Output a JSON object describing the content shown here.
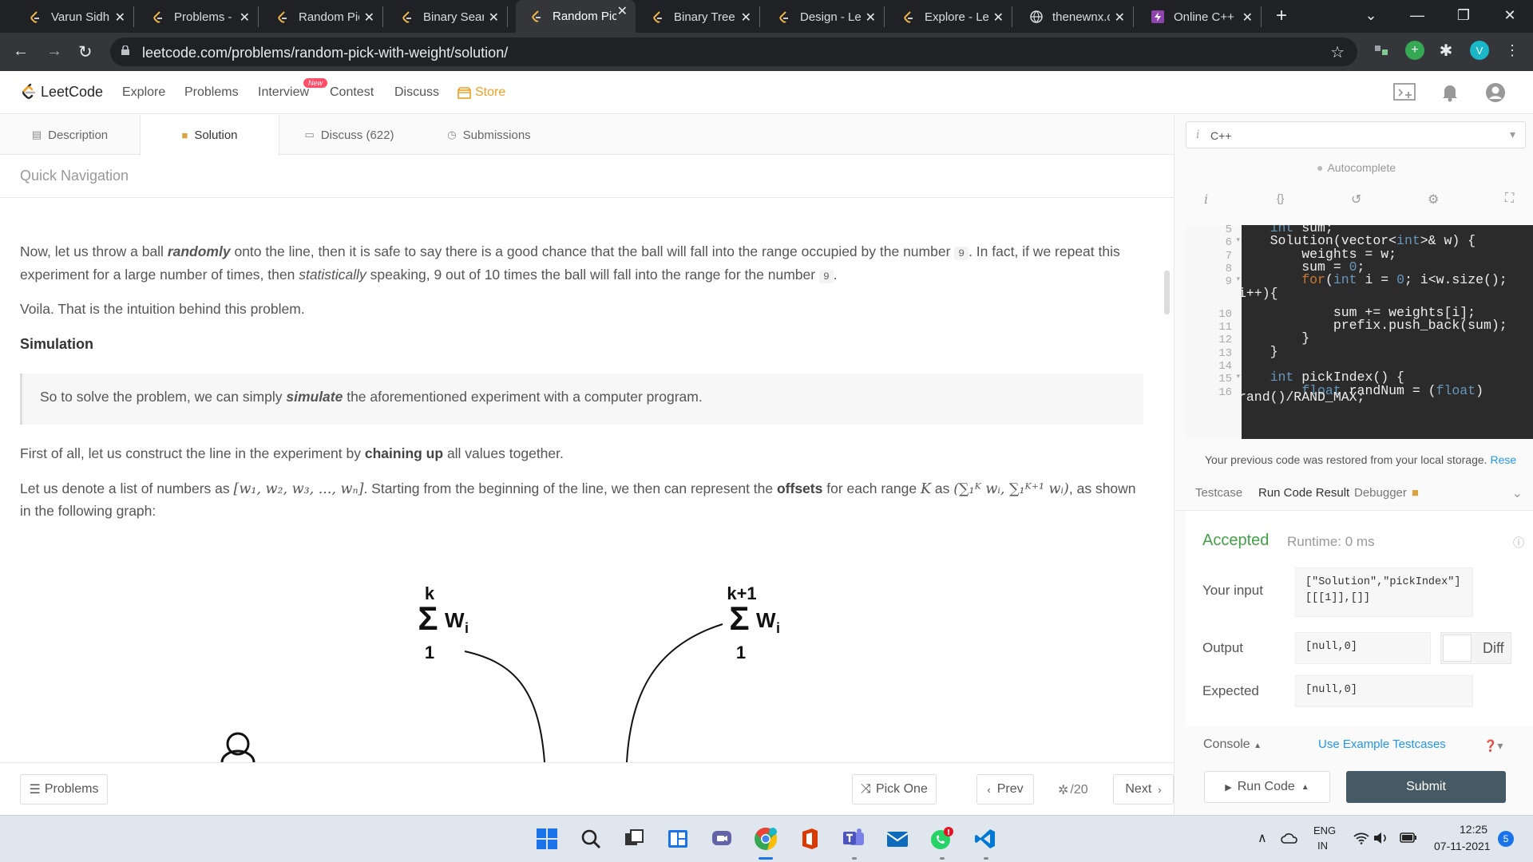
{
  "browser": {
    "tabs": [
      {
        "title": "Varun Sidhu",
        "icon": "leetcode-favicon"
      },
      {
        "title": "Problems -",
        "icon": "leetcode-favicon"
      },
      {
        "title": "Random Pic",
        "icon": "leetcode-favicon"
      },
      {
        "title": "Binary Searc",
        "icon": "leetcode-favicon"
      },
      {
        "title": "Random Pic",
        "icon": "leetcode-favicon",
        "active": true
      },
      {
        "title": "Binary Tree",
        "icon": "leetcode-favicon"
      },
      {
        "title": "Design - Le",
        "icon": "leetcode-favicon"
      },
      {
        "title": "Explore - Le",
        "icon": "leetcode-favicon"
      },
      {
        "title": "thenewnx.c",
        "icon": "globe-favicon"
      },
      {
        "title": "Online C++",
        "icon": "bolt-favicon"
      }
    ],
    "url": "leetcode.com/problems/random-pick-with-weight/solution/",
    "profile_initial": "V"
  },
  "lc_nav": {
    "brand": "LeetCode",
    "links": [
      "Explore",
      "Problems",
      "Interview",
      "Contest",
      "Discuss"
    ],
    "new_badge": "New",
    "store": "Store"
  },
  "problem_tabs": [
    {
      "label": "Description",
      "icon": "description-icon"
    },
    {
      "label": "Solution",
      "icon": "lock-icon",
      "active": true
    },
    {
      "label": "Discuss (622)",
      "icon": "discuss-icon"
    },
    {
      "label": "Submissions",
      "icon": "clock-icon"
    }
  ],
  "quick_nav": "Quick Navigation",
  "article": {
    "p1": {
      "a": "Now, let us throw a ball ",
      "b": "randomly",
      "c": " onto the line, then it is safe to say there is a good chance that the ball will fall into the range occupied by the number ",
      "code1": "9",
      "d": ". In fact, if we repeat this experiment for a large number of times, then ",
      "e": "statistically",
      "f": " speaking, 9 out of 10 times the ball will fall into the range for the number ",
      "code2": "9",
      "g": "."
    },
    "p2": "Voila. That is the intuition behind this problem.",
    "heading": "Simulation",
    "quote": {
      "a": "So to solve the problem, we can simply ",
      "b": "simulate",
      "c": " the aforementioned experiment with a computer program."
    },
    "p3": {
      "a": "First of all, let us construct the line in the experiment by ",
      "b": "chaining up",
      "c": " all values together."
    },
    "p4": {
      "a": "Let us denote a list of numbers as ",
      "list": "[w₁, w₂, w₃, ..., wₙ]",
      "b": ". Starting from the beginning of the line, we then can represent the ",
      "c": "offsets",
      "d": " for each range ",
      "k": "K",
      "e": " as ",
      "range": "(∑₁ᴷ wᵢ, ∑₁ᴷ⁺¹ wᵢ)",
      "f": ", as shown in the following graph:"
    },
    "figure": {
      "left": {
        "top": "k",
        "sigma": "Σ",
        "w": "W",
        "sub": "i",
        "bottom": "1"
      },
      "right": {
        "top": "k+1",
        "sigma": "Σ",
        "w": "W",
        "sub": "i",
        "bottom": "1"
      }
    }
  },
  "bottom_bar": {
    "problems": "Problems",
    "pick_one": "Pick One",
    "prev": "Prev",
    "page": "/20",
    "next": "Next"
  },
  "editor": {
    "language": "C++",
    "autocomplete": "Autocomplete",
    "line_numbers": [
      "5",
      "6",
      "7",
      "8",
      "9",
      "",
      "10",
      "11",
      "12",
      "13",
      "14",
      "15",
      "16",
      ""
    ],
    "lines": [
      "    int sum;",
      "    Solution(vector<int>& w) {",
      "        weights = w;",
      "        sum = 0;",
      "        for(int i = 0; i<w.size();",
      "i++){",
      "            sum += weights[i];",
      "            prefix.push_back(sum);",
      "        }",
      "    }",
      "",
      "    int pickIndex() {",
      "        float randNum = (float)",
      "rand()/RAND_MAX;"
    ]
  },
  "restore_msg": {
    "text": "Your previous code was restored from your local storage.",
    "link": "Rese"
  },
  "result_tabs": [
    "Testcase",
    "Run Code Result",
    "Debugger"
  ],
  "result": {
    "status": "Accepted",
    "runtime": "Runtime: 0 ms",
    "input_label": "Your input",
    "input_lines": [
      "[\"Solution\",\"pickIndex\"]",
      "[[[1]],[]]"
    ],
    "output_label": "Output",
    "output": "[null,0]",
    "diff": "Diff",
    "expected_label": "Expected",
    "expected": "[null,0]"
  },
  "console": {
    "label": "Console",
    "example": "Use Example Testcases"
  },
  "actions": {
    "run": "Run Code",
    "submit": "Submit"
  },
  "taskbar": {
    "lang": "ENG",
    "region": "IN",
    "time": "12:25",
    "date": "07-11-2021",
    "notif": "5"
  }
}
